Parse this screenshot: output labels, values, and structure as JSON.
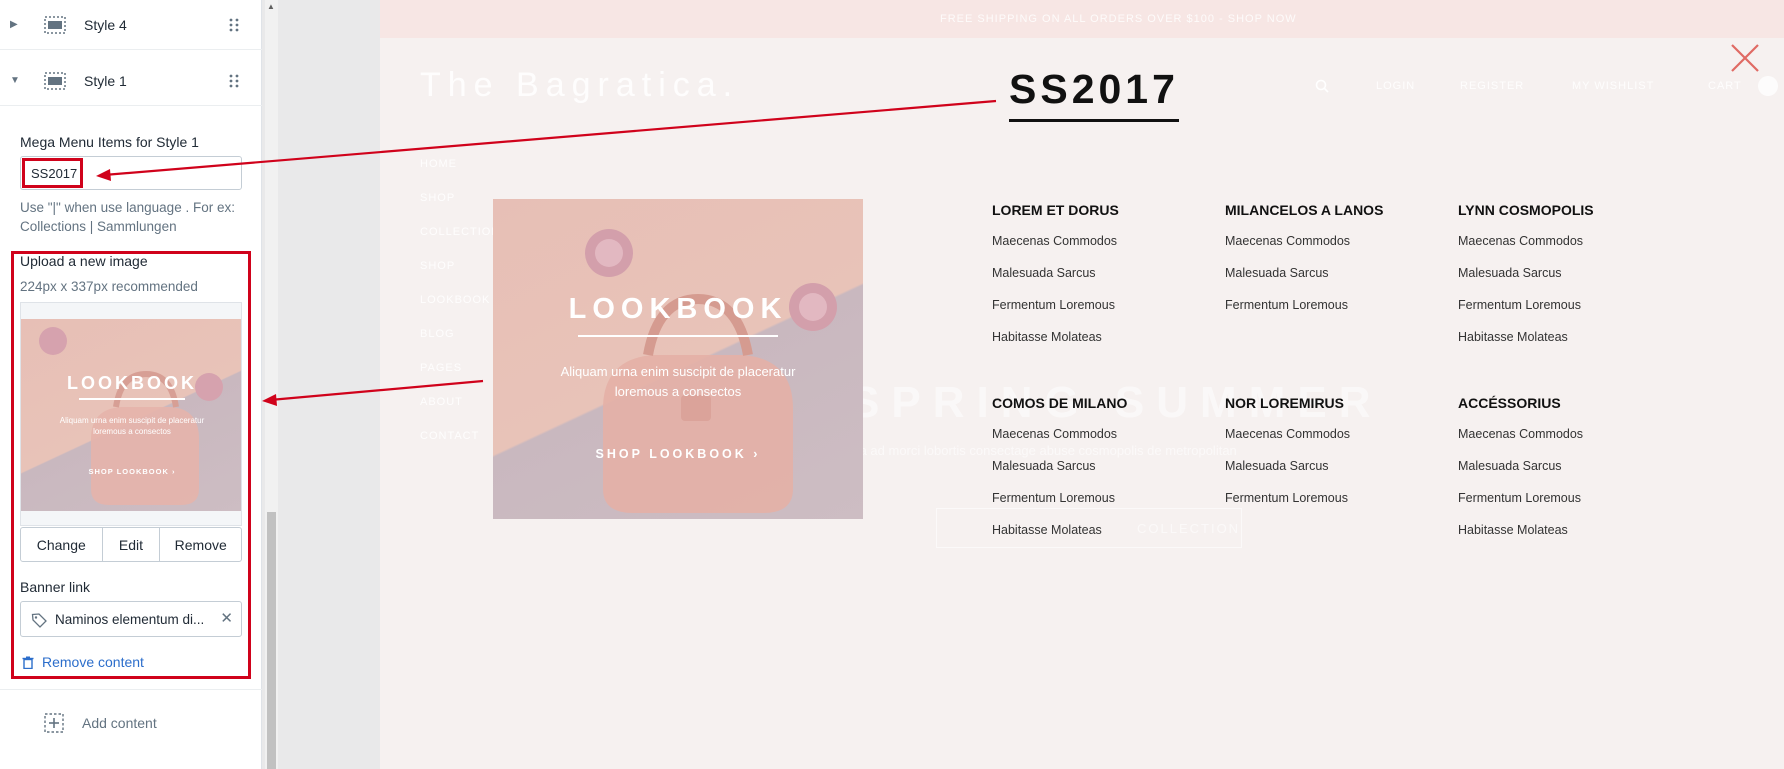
{
  "sidebar": {
    "blocks": [
      {
        "label": "Style 4",
        "expanded": false
      },
      {
        "label": "Style 1",
        "expanded": true
      }
    ],
    "items_field": {
      "label": "Mega Menu Items for Style 1",
      "value": "SS2017",
      "help_line1": "Use \"|\" when use language . For ex:",
      "help_line2": "Collections | Sammlungen"
    },
    "image_field": {
      "label": "Upload a new image",
      "help": "224px x 337px recommended",
      "thumb_title": "LOOKBOOK",
      "thumb_sub1": "Aliquam urna enim suscipit de placeratur",
      "thumb_sub2": "loremous a consectos",
      "thumb_shop": "SHOP LOOKBOOK  ›",
      "buttons": [
        "Change",
        "Edit",
        "Remove"
      ]
    },
    "banner_link": {
      "label": "Banner link",
      "value": "Naminos elementum di..."
    },
    "remove_content": "Remove content",
    "add_content": "Add content"
  },
  "preview": {
    "top_bar_text": "FREE SHIPPING ON ALL ORDERS OVER $100 - SHOP NOW",
    "logo": "The Bagratica.",
    "nav_top": [
      "LOGIN",
      "REGISTER",
      "MY WISHLIST",
      "CART"
    ],
    "nav_left": [
      "HOME",
      "SHOP",
      "COLLECTIONS",
      "SHOP",
      "LOOKBOOK",
      "BLOG",
      "PAGES",
      "ABOUT",
      "CONTACT"
    ],
    "hero": {
      "title": "SPRING SUMMER",
      "subtitle": "Desuda ad morci lobortis consectage abuse cosmopolis de metropolitan",
      "button": "COLLECTION"
    },
    "menu_title": "SS2017",
    "banner": {
      "title": "LOOKBOOK",
      "sub1": "Aliquam urna enim suscipit de placeratur",
      "sub2": "loremous a consectos",
      "shop": "SHOP LOOKBOOK  ›"
    },
    "columns": [
      {
        "title": "LOREM ET DORUS",
        "items": [
          "Maecenas Commodos",
          "Malesuada Sarcus",
          "Fermentum Loremous",
          "Habitasse Molateas"
        ]
      },
      {
        "title": "MILANCELOS A LANOS",
        "items": [
          "Maecenas Commodos",
          "Malesuada Sarcus",
          "Fermentum Loremous"
        ]
      },
      {
        "title": "LYNN COSMOPOLIS",
        "items": [
          "Maecenas Commodos",
          "Malesuada Sarcus",
          "Fermentum Loremous",
          "Habitasse Molateas"
        ]
      },
      {
        "title": "COMOS DE MILANO",
        "items": [
          "Maecenas Commodos",
          "Malesuada Sarcus",
          "Fermentum Loremous",
          "Habitasse Molateas"
        ]
      },
      {
        "title": "NOR LOREMIRUS",
        "items": [
          "Maecenas Commodos",
          "Malesuada Sarcus",
          "Fermentum Loremous"
        ]
      },
      {
        "title": "ACCÉSSORIUS",
        "items": [
          "Maecenas Commodos",
          "Malesuada Sarcus",
          "Fermentum Loremous",
          "Habitasse Molateas"
        ]
      }
    ]
  },
  "colors": {
    "annotation": "#d0021b",
    "link": "#2c6ecb",
    "banner_pink": "#e8c3b8"
  }
}
